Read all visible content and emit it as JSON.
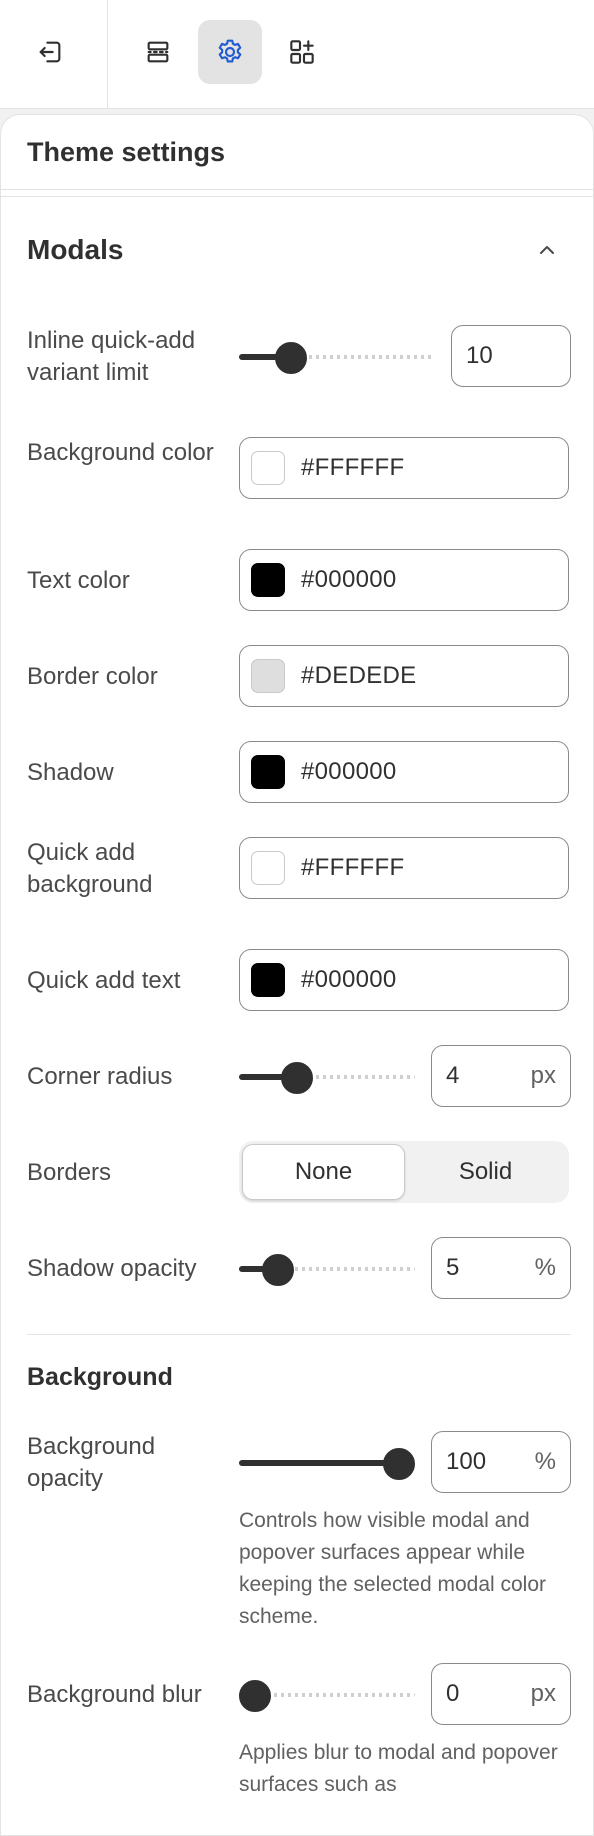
{
  "toolbar": {
    "exit_icon": "exit-icon",
    "sections_icon": "sections-icon",
    "settings_icon": "gear-icon",
    "apps_icon": "apps-add-icon"
  },
  "panel": {
    "title": "Theme settings"
  },
  "modals": {
    "title": "Modals",
    "inline_quick_add": {
      "label": "Inline quick-add variant limit",
      "value": "10",
      "fraction": 0.22
    },
    "background_color": {
      "label": "Background color",
      "value": "#FFFFFF",
      "swatch": "#FFFFFF"
    },
    "text_color": {
      "label": "Text color",
      "value": "#000000",
      "swatch": "#000000"
    },
    "border_color": {
      "label": "Border color",
      "value": "#DEDEDE",
      "swatch": "#DEDEDE"
    },
    "shadow": {
      "label": "Shadow",
      "value": "#000000",
      "swatch": "#000000"
    },
    "quick_add_background": {
      "label": "Quick add background",
      "value": "#FFFFFF",
      "swatch": "#FFFFFF"
    },
    "quick_add_text": {
      "label": "Quick add text",
      "value": "#000000",
      "swatch": "#000000"
    },
    "corner_radius": {
      "label": "Corner radius",
      "value": "4",
      "unit": "px",
      "fraction": 0.29
    },
    "borders": {
      "label": "Borders",
      "options": [
        "None",
        "Solid"
      ],
      "selected": "None"
    },
    "shadow_opacity": {
      "label": "Shadow opacity",
      "value": "5",
      "unit": "%",
      "fraction": 0.16
    }
  },
  "background": {
    "title": "Background",
    "opacity": {
      "label": "Background opacity",
      "value": "100",
      "unit": "%",
      "fraction": 1.0,
      "help": "Controls how visible modal and popover surfaces appear while keeping the selected modal color scheme."
    },
    "blur": {
      "label": "Background blur",
      "value": "0",
      "unit": "px",
      "fraction": 0.0,
      "help": "Applies blur to modal and popover surfaces such as"
    }
  }
}
